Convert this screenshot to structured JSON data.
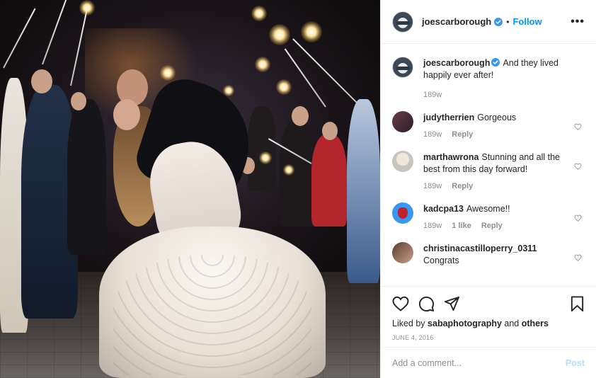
{
  "post": {
    "photo": {
      "icon": "wedding-sparkler-photo"
    },
    "header": {
      "username": "joescarborough",
      "follow_label": "Follow",
      "separator": "•",
      "more_label": "•••"
    },
    "caption": {
      "username": "joescarborough",
      "text": "And they lived happily ever after!",
      "time": "189w"
    },
    "comments": [
      {
        "username": "judytherrien",
        "text": "Gorgeous",
        "time": "189w",
        "likes": "",
        "reply_label": "Reply"
      },
      {
        "username": "marthawrona",
        "text": "Stunning and all the best from this day forward!",
        "time": "189w",
        "likes": "",
        "reply_label": "Reply"
      },
      {
        "username": "kadcpa13",
        "text": "Awesome!!",
        "time": "189w",
        "likes": "1 like",
        "reply_label": "Reply"
      },
      {
        "username": "christinacastilloperry_0311",
        "text": "Congrats",
        "time": "",
        "likes": "",
        "reply_label": ""
      }
    ],
    "likes": {
      "prefix": "Liked by",
      "user": "sabaphotography",
      "conjunction": "and",
      "others": "others"
    },
    "date": "JUNE 4, 2016",
    "add_comment": {
      "placeholder": "Add a comment...",
      "post_label": "Post"
    },
    "colors": {
      "accent": "#0095f6",
      "post_disabled": "#b2dffc",
      "muted": "#8e8e8e",
      "text": "#262626"
    }
  }
}
